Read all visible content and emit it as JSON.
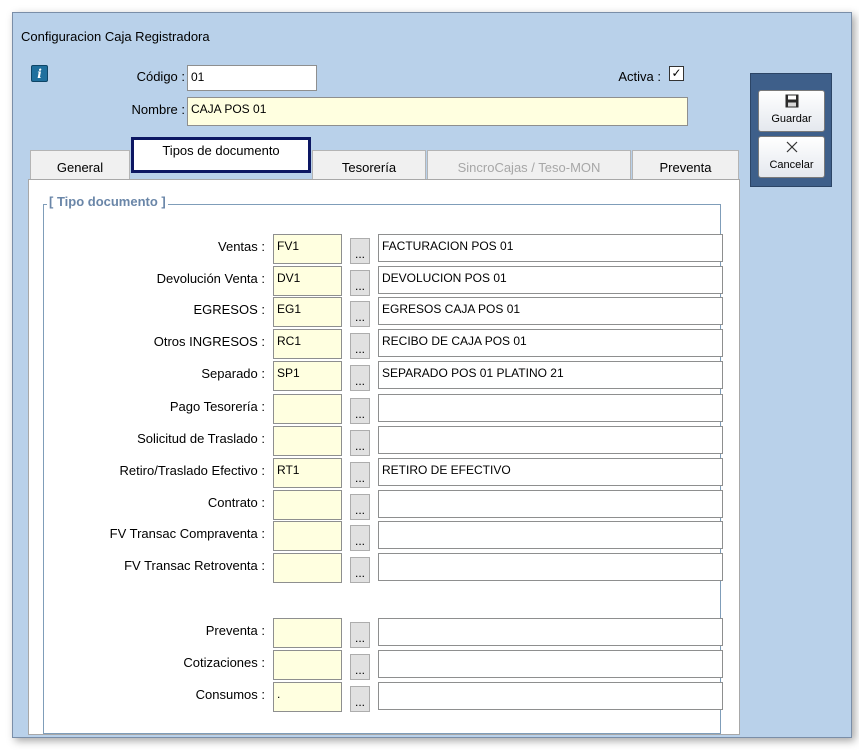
{
  "window": {
    "title": "Configuracion Caja Registradora"
  },
  "header": {
    "codigo_label": "Código :",
    "codigo_value": "01",
    "activa_label": "Activa :",
    "activa_checked": true,
    "nombre_label": "Nombre :",
    "nombre_value": "CAJA POS 01",
    "info_icon": "info-icon"
  },
  "actions": {
    "guardar_label": "Guardar",
    "guardar_icon": "floppy-disk-icon",
    "cancelar_label": "Cancelar",
    "cancelar_icon": "close-x-icon"
  },
  "tabs": [
    {
      "label": "General",
      "active": false,
      "disabled": false
    },
    {
      "label": "Tipos de documento",
      "active": true,
      "disabled": false
    },
    {
      "label": "Tesorería",
      "active": false,
      "disabled": false
    },
    {
      "label": "SincroCajas / Teso-MON",
      "active": false,
      "disabled": true
    },
    {
      "label": "Preventa",
      "active": false,
      "disabled": false
    }
  ],
  "group": {
    "title": "[ Tipo documento ]"
  },
  "rows": [
    {
      "label": "Ventas :",
      "code": "FV1",
      "desc": "FACTURACION POS 01"
    },
    {
      "label": "Devolución Venta :",
      "code": "DV1",
      "desc": "DEVOLUCION POS 01"
    },
    {
      "label": "EGRESOS :",
      "code": "EG1",
      "desc": "EGRESOS CAJA POS 01"
    },
    {
      "label": "Otros INGRESOS :",
      "code": "RC1",
      "desc": "RECIBO DE CAJA POS 01"
    },
    {
      "label": "Separado :",
      "code": "SP1",
      "desc": "SEPARADO POS 01 PLATINO 21"
    },
    {
      "label": "Pago Tesorería :",
      "code": "",
      "desc": ""
    },
    {
      "label": "Solicitud de Traslado :",
      "code": "",
      "desc": ""
    },
    {
      "label": "Retiro/Traslado Efectivo :",
      "code": "RT1",
      "desc": "RETIRO DE EFECTIVO"
    },
    {
      "label": "Contrato :",
      "code": "",
      "desc": ""
    },
    {
      "label": "FV Transac Compraventa :",
      "code": "",
      "desc": ""
    },
    {
      "label": "FV Transac Retroventa :",
      "code": "",
      "desc": ""
    },
    {
      "label": "Preventa :",
      "code": "",
      "desc": ""
    },
    {
      "label": "Cotizaciones :",
      "code": "",
      "desc": ""
    },
    {
      "label": "Consumos :",
      "code": ".",
      "desc": ""
    }
  ],
  "lookup_button_label": "...",
  "colors": {
    "window_bg": "#b9d1ea",
    "side_panel": "#3e5f8a",
    "input_highlight": "#ffffe0",
    "active_tab_border": "#0c1763",
    "group_title": "#6a86a8"
  }
}
